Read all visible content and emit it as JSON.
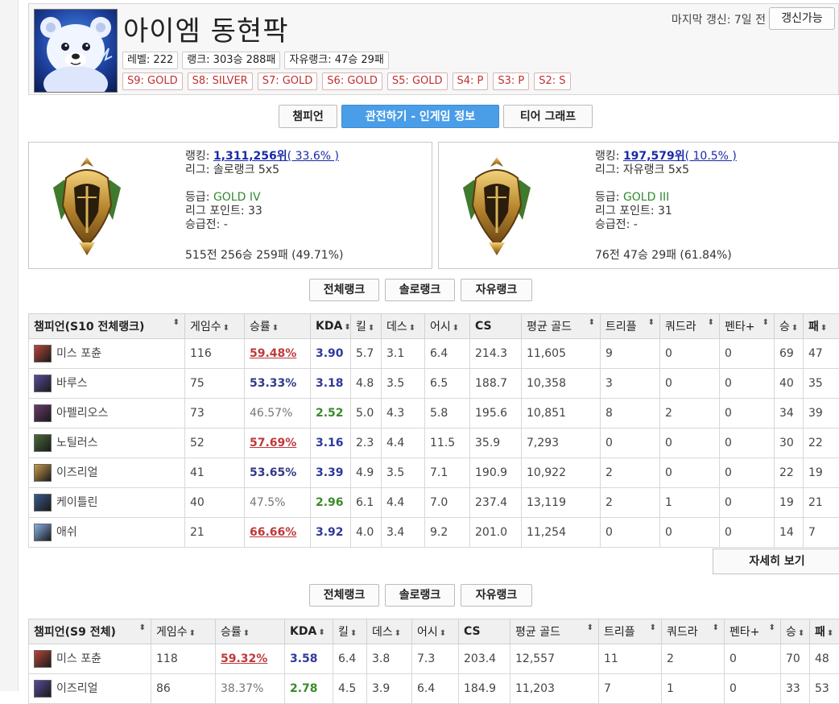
{
  "profile": {
    "name": "아이엠 동현팍",
    "last_update": "마지막 갱신: 7일 전",
    "refresh_label": "갱신가능",
    "stats": [
      "레벨: 222",
      "랭크: 303승 288패",
      "자유랭크: 47승 29패"
    ],
    "seasons": [
      "S9: GOLD",
      "S8: SILVER",
      "S7: GOLD",
      "S6: GOLD",
      "S5: GOLD",
      "S4: P",
      "S3: P",
      "S2: S"
    ]
  },
  "tabs": [
    "챔피언",
    "관전하기 - 인게임 정보",
    "티어 그래프"
  ],
  "solo": {
    "ranking_label": "랭킹: ",
    "ranking_value": "1,311,256위",
    "ranking_pct": "( 33.6% )",
    "league": "리그: 솔로랭크 5x5",
    "tier_label": "등급: ",
    "tier": "GOLD IV",
    "points": "리그 포인트: 33",
    "promo": "승급전: -",
    "record": "515전 256승 259패 (49.71%)"
  },
  "flex": {
    "ranking_label": "랭킹: ",
    "ranking_value": "197,579위",
    "ranking_pct": "( 10.5% )",
    "league": "리그: 자유랭크 5x5",
    "tier_label": "등급: ",
    "tier": "GOLD III",
    "points": "리그 포인트: 31",
    "promo": "승급전: -",
    "record": "76전 47승 29패 (61.84%)"
  },
  "filters": [
    "전체랭크",
    "솔로랭크",
    "자유랭크"
  ],
  "table1": {
    "headers": [
      "챔피언(S10 전체랭크)",
      "게임수",
      "승률",
      "KDA",
      "킬",
      "데스",
      "어시",
      "CS",
      "평균 골드",
      "트리플",
      "쿼드라",
      "펜타+",
      "승",
      "패"
    ],
    "rows": [
      [
        "미스 포츈",
        "116",
        "59.48%",
        "3.90",
        "5.7",
        "3.1",
        "6.4",
        "214.3",
        "11,605",
        "9",
        "0",
        "0",
        "69",
        "47"
      ],
      [
        "바루스",
        "75",
        "53.33%",
        "3.18",
        "4.8",
        "3.5",
        "6.5",
        "188.7",
        "10,358",
        "3",
        "0",
        "0",
        "40",
        "35"
      ],
      [
        "아펠리오스",
        "73",
        "46.57%",
        "2.52",
        "5.0",
        "4.3",
        "5.8",
        "195.6",
        "10,851",
        "8",
        "2",
        "0",
        "34",
        "39"
      ],
      [
        "노틸러스",
        "52",
        "57.69%",
        "3.16",
        "2.3",
        "4.4",
        "11.5",
        "35.9",
        "7,293",
        "0",
        "0",
        "0",
        "30",
        "22"
      ],
      [
        "이즈리얼",
        "41",
        "53.65%",
        "3.39",
        "4.9",
        "3.5",
        "7.1",
        "190.9",
        "10,922",
        "2",
        "0",
        "0",
        "22",
        "19"
      ],
      [
        "케이틀린",
        "40",
        "47.5%",
        "2.96",
        "6.1",
        "4.4",
        "7.0",
        "237.4",
        "13,119",
        "2",
        "1",
        "0",
        "19",
        "21"
      ],
      [
        "애쉬",
        "21",
        "66.66%",
        "3.92",
        "4.0",
        "3.4",
        "9.2",
        "201.0",
        "11,254",
        "0",
        "0",
        "0",
        "14",
        "7"
      ]
    ]
  },
  "more_label": "자세히 보기",
  "table2": {
    "headers": [
      "챔피언(S9 전체)",
      "게임수",
      "승률",
      "KDA",
      "킬",
      "데스",
      "어시",
      "CS",
      "평균 골드",
      "트리플",
      "쿼드라",
      "펜타+",
      "승",
      "패"
    ],
    "rows": [
      [
        "미스 포츈",
        "118",
        "59.32%",
        "3.58",
        "6.4",
        "3.8",
        "7.3",
        "203.4",
        "12,557",
        "11",
        "2",
        "0",
        "70",
        "48"
      ],
      [
        "이즈리얼",
        "86",
        "38.37%",
        "2.78",
        "4.5",
        "3.9",
        "6.4",
        "184.9",
        "11,203",
        "7",
        "1",
        "0",
        "33",
        "53"
      ]
    ]
  },
  "colors": {
    "accent_tab": "#4a9ee8",
    "winrate_high": "#c0393b",
    "kda_blue": "#2e3a9a",
    "kda_green": "#3a8a2a",
    "season_red": "#c03030",
    "tier_green": "#2f8a2f"
  },
  "icons": {
    "avatar": "polar-bear-icon",
    "emblem": "gold-rank-emblem-icon",
    "sort": "sort-arrows-icon"
  }
}
